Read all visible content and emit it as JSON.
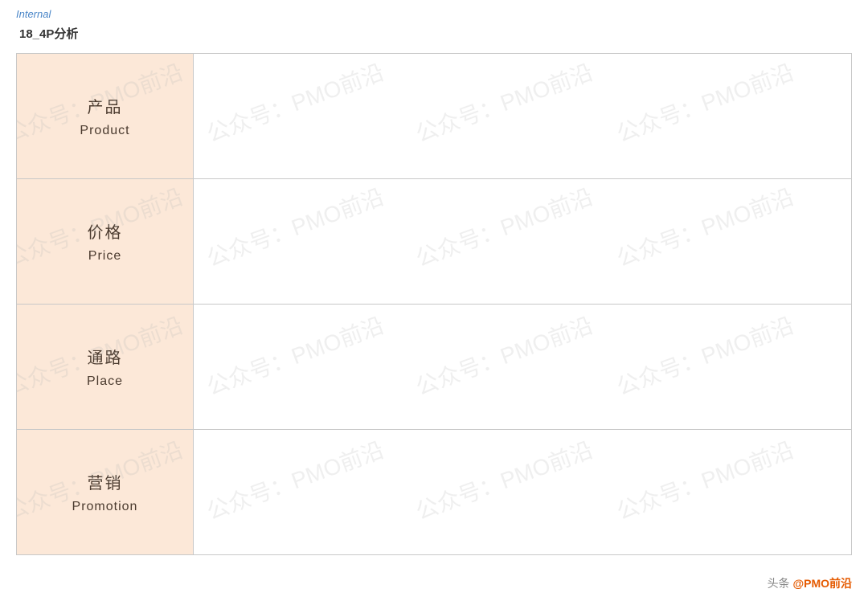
{
  "page": {
    "internal_label": "Internal",
    "title": "18_4P分析"
  },
  "rows": [
    {
      "id": "product",
      "label_zh": "产品",
      "label_en": "Product"
    },
    {
      "id": "price",
      "label_zh": "价格",
      "label_en": "Price"
    },
    {
      "id": "place",
      "label_zh": "通路",
      "label_en": "Place"
    },
    {
      "id": "promotion",
      "label_zh": "营销",
      "label_en": "Promotion"
    }
  ],
  "watermarks": [
    "公众号：PMO前沿",
    "公众号：PMO前沿",
    "公众号：PMO前沿"
  ],
  "footer": {
    "text": "头条 @PMO前沿"
  }
}
